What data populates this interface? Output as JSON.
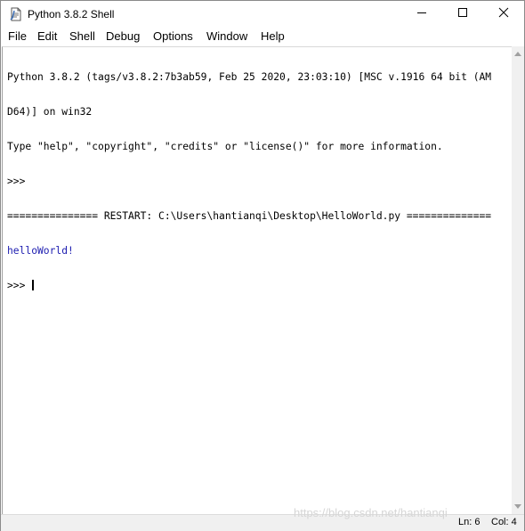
{
  "window": {
    "title": "Python 3.8.2 Shell",
    "icons": {
      "app": "idle-document-icon",
      "minimize": "minimize-icon",
      "maximize": "maximize-icon",
      "close": "close-icon"
    }
  },
  "menubar": {
    "items": [
      "File",
      "Edit",
      "Shell",
      "Debug",
      "Options",
      "Window",
      "Help"
    ]
  },
  "shell": {
    "lines": [
      {
        "kind": "info",
        "text": "Python 3.8.2 (tags/v3.8.2:7b3ab59, Feb 25 2020, 23:03:10) [MSC v.1916 64 bit (AM"
      },
      {
        "kind": "info",
        "text": "D64)] on win32"
      },
      {
        "kind": "info",
        "text": "Type \"help\", \"copyright\", \"credits\" or \"license()\" for more information."
      },
      {
        "kind": "prompt",
        "text": ">>> "
      },
      {
        "kind": "restart",
        "text": "=============== RESTART: C:\\Users\\hantianqi\\Desktop\\HelloWorld.py =============="
      },
      {
        "kind": "output",
        "text": "helloWorld!"
      },
      {
        "kind": "prompt",
        "text": ">>> "
      }
    ],
    "output_color": "#1c1cb0"
  },
  "statusbar": {
    "line": "Ln: 6",
    "col": "Col: 4"
  },
  "watermark": "https://blog.csdn.net/hantianqi"
}
